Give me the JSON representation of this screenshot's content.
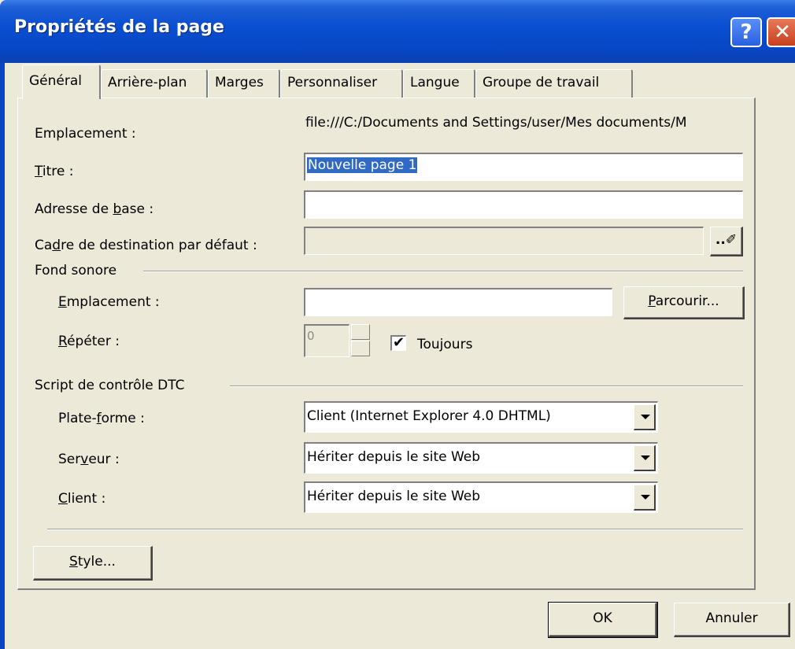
{
  "window": {
    "title": "Propriétés de la page",
    "help_glyph": "?",
    "close_glyph": "✕"
  },
  "tabs": [
    {
      "label": "Général",
      "active": true
    },
    {
      "label": "Arrière-plan",
      "active": false
    },
    {
      "label": "Marges",
      "active": false
    },
    {
      "label": "Personnaliser",
      "active": false
    },
    {
      "label": "Langue",
      "active": false
    },
    {
      "label": "Groupe de travail",
      "active": false
    }
  ],
  "general": {
    "location_label": "Emplacement :",
    "location_value": "file:///C:/Documents and Settings/user/Mes documents/M",
    "title_label_ul": "T",
    "title_label_rest": "itre :",
    "title_value": "Nouvelle page 1",
    "base_label_pre": "Adresse de ",
    "base_label_ul": "b",
    "base_label_post": "ase :",
    "base_value": "",
    "target_label_pre": "Ca",
    "target_label_ul": "d",
    "target_label_post": "re de destination par défaut :",
    "target_value": "",
    "target_button": "..✐"
  },
  "background_sound": {
    "group_label": "Fond sonore",
    "location_label_ul": "E",
    "location_label_rest": "mplacement :",
    "location_value": "",
    "browse_ul": "P",
    "browse_rest": "arcourir...",
    "repeat_label_ul": "R",
    "repeat_label_rest": "épéter :",
    "repeat_value": "0",
    "always_label_pre": "Tou",
    "always_label_ul": "j",
    "always_label_post": "ours",
    "always_checked": "✔"
  },
  "dtc": {
    "group_label": "Script de contrôle DTC",
    "platform_label_pre": "Plate-",
    "platform_label_ul": "f",
    "platform_label_post": "orme :",
    "platform_value": "Client (Internet Explorer 4.0 DHTML)",
    "server_label_pre": "Ser",
    "server_label_ul": "v",
    "server_label_post": "eur :",
    "server_value": "Hériter depuis le site Web",
    "client_label_ul": "C",
    "client_label_rest": "lient :",
    "client_value": "Hériter depuis le site Web"
  },
  "style_button_ul": "S",
  "style_button_rest": "tyle...",
  "footer": {
    "ok": "OK",
    "cancel": "Annuler"
  }
}
